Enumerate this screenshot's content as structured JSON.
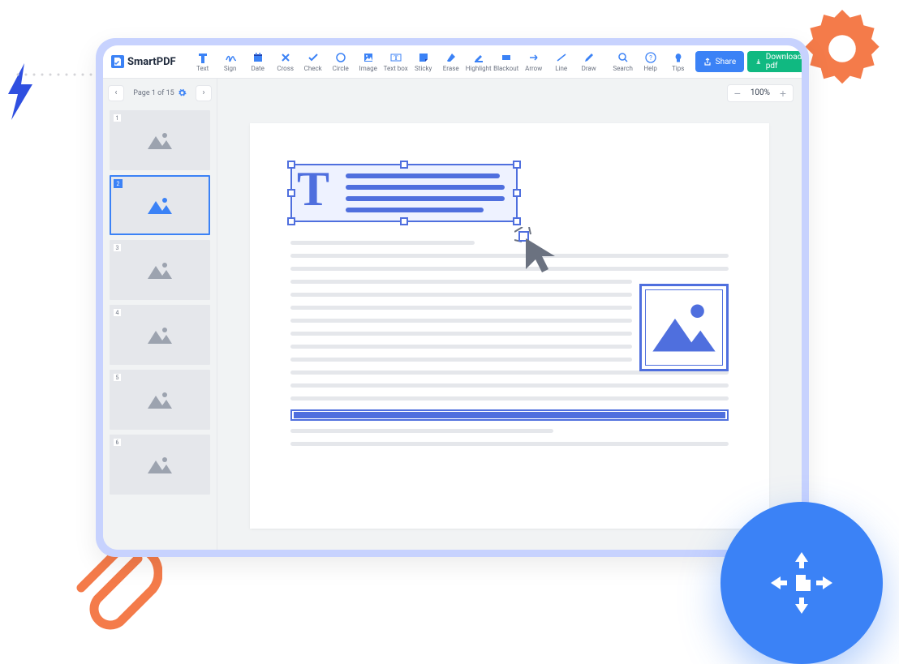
{
  "brand": "SmartPDF",
  "tools": [
    {
      "id": "text",
      "label": "Text"
    },
    {
      "id": "sign",
      "label": "Sign"
    },
    {
      "id": "date",
      "label": "Date"
    },
    {
      "id": "cross",
      "label": "Cross"
    },
    {
      "id": "check",
      "label": "Check"
    },
    {
      "id": "circle",
      "label": "Circle"
    },
    {
      "id": "image",
      "label": "Image"
    },
    {
      "id": "textbox",
      "label": "Text box"
    },
    {
      "id": "sticky",
      "label": "Sticky"
    },
    {
      "id": "erase",
      "label": "Erase"
    },
    {
      "id": "highlight",
      "label": "Highlight"
    },
    {
      "id": "blackout",
      "label": "Blackout"
    },
    {
      "id": "arrow",
      "label": "Arrow"
    },
    {
      "id": "line",
      "label": "Line"
    },
    {
      "id": "draw",
      "label": "Draw"
    }
  ],
  "right_tools": [
    {
      "id": "search",
      "label": "Search"
    },
    {
      "id": "help",
      "label": "Help"
    },
    {
      "id": "tips",
      "label": "Tips"
    }
  ],
  "buttons": {
    "share": "Share",
    "download": "Download pdf"
  },
  "sidebar": {
    "page_label": "Page 1 of 15",
    "pages": [
      1,
      2,
      3,
      4,
      5,
      6
    ],
    "active": 2
  },
  "zoom": "100%",
  "text_placeholder": "T"
}
